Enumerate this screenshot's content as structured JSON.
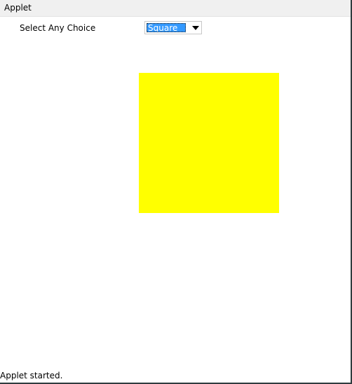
{
  "menu": {
    "applet_label": "Applet"
  },
  "applet": {
    "choice_label": "Select Any Choice",
    "dropdown": {
      "selected": "Square"
    },
    "shape": {
      "type": "square",
      "color": "#ffff00"
    }
  },
  "status": {
    "text": "Applet started."
  },
  "colors": {
    "selection_highlight": "#3399ff",
    "window_frame": "#2f3b3e"
  }
}
